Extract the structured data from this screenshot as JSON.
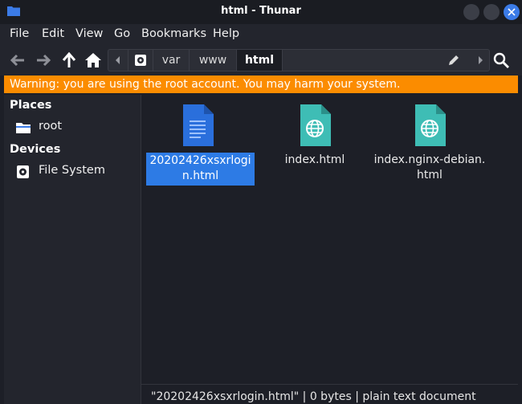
{
  "window": {
    "title": "html - Thunar"
  },
  "menu": [
    "File",
    "Edit",
    "View",
    "Go",
    "Bookmarks",
    "Help"
  ],
  "toolbar": {
    "buttons": [
      "back-arrow-icon",
      "forward-arrow-icon",
      "up-arrow-icon",
      "home-icon"
    ],
    "path": [
      "var",
      "www",
      "html"
    ],
    "active_segment": "html"
  },
  "warning": {
    "text": "Warning: you are using the root account. You may harm your system.",
    "color": "#fb8c00"
  },
  "sidebar": {
    "places_header": "Places",
    "places": [
      {
        "label": "root",
        "icon": "folder-icon"
      }
    ],
    "devices_header": "Devices",
    "devices": [
      {
        "label": "File System",
        "icon": "drive-icon"
      }
    ]
  },
  "files": [
    {
      "name": "20202426xsxrlogin.html",
      "icon": "document-icon",
      "selected": true,
      "color": "#2a6fdc"
    },
    {
      "name": "index.html",
      "icon": "globe-icon",
      "selected": false,
      "color": "#3ebdb5"
    },
    {
      "name": "index.nginx-debian.html",
      "icon": "globe-icon",
      "selected": false,
      "color": "#3ebdb5"
    }
  ],
  "status": {
    "text": "\"20202426xsxrlogin.html\" | 0 bytes | plain text document"
  },
  "colors": {
    "selection": "#2d7be5",
    "accent": "#3b7be7"
  }
}
